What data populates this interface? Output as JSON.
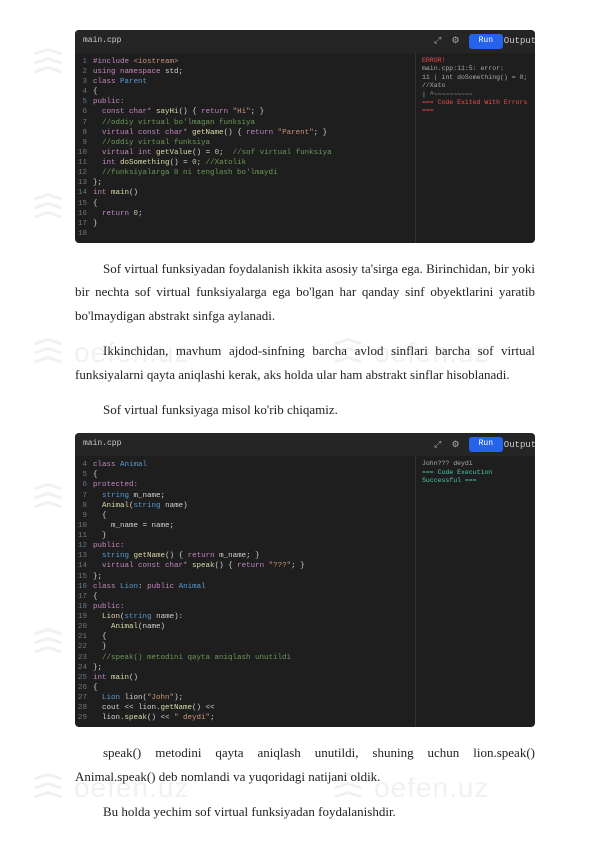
{
  "watermark": "oefen.uz",
  "editor1": {
    "filename": "main.cpp",
    "runLabel": "Run",
    "outputTitle": "Output",
    "lines": [
      {
        "n": "1",
        "html": "<span class='tok-keyword'>#include</span> <span class='tok-string'>&lt;iostream&gt;</span>"
      },
      {
        "n": "2",
        "html": "<span class='tok-keyword'>using namespace</span> <span class='tok-plain'>std;</span>"
      },
      {
        "n": "3",
        "html": "<span class='tok-keyword'>class</span> <span class='tok-type'>Parent</span>"
      },
      {
        "n": "4",
        "html": "<span class='tok-plain'>{</span>"
      },
      {
        "n": "5",
        "html": "<span class='tok-keyword'>public:</span>"
      },
      {
        "n": "6",
        "html": "  <span class='tok-keyword'>const char*</span> <span class='tok-func'>sayHi</span>() { <span class='tok-keyword'>return</span> <span class='tok-string'>\"Hi\"</span>; }"
      },
      {
        "n": "7",
        "html": "  <span class='tok-comment'>//oddiy virtual bo'lmagan funksiya</span>"
      },
      {
        "n": "8",
        "html": "  <span class='tok-keyword'>virtual const char*</span> <span class='tok-func'>getName</span>() { <span class='tok-keyword'>return</span> <span class='tok-string'>\"Parent\"</span>; }"
      },
      {
        "n": "9",
        "html": "  <span class='tok-comment'>//oddiy virtual funksiya</span>"
      },
      {
        "n": "10",
        "html": "  <span class='tok-keyword'>virtual int</span> <span class='tok-func'>getValue</span>() = <span class='tok-number'>0</span>;  <span class='tok-comment'>//sof virtual funksiya</span>"
      },
      {
        "n": "11",
        "html": "  <span class='tok-keyword'>int</span> <span class='tok-func'>doSomething</span>() = <span class='tok-number'>0</span>; <span class='tok-comment'>//Xatolik</span>"
      },
      {
        "n": "12",
        "html": "  <span class='tok-comment'>//funksiyalarga 0 ni tenglash bo'lmaydi</span>"
      },
      {
        "n": "13",
        "html": "<span class='tok-plain'>};</span>"
      },
      {
        "n": "14",
        "html": "<span class='tok-keyword'>int</span> <span class='tok-func'>main</span>()"
      },
      {
        "n": "15",
        "html": "<span class='tok-plain'>{</span>"
      },
      {
        "n": "16",
        "html": "  <span class='tok-keyword'>return</span> <span class='tok-number'>0</span>;"
      },
      {
        "n": "17",
        "html": "<span class='tok-plain'>}</span>"
      },
      {
        "n": "18",
        "html": ""
      }
    ],
    "output": {
      "error": "ERROR!",
      "lines": [
        "main.cpp:11:5: error:",
        "11 |   int  doSomething() = 0; //Xato",
        "   |       ^~~~~~~~~~~",
        "",
        "=== Code Exited With Errors ==="
      ]
    }
  },
  "para1": "Sof virtual funksiyadan foydalanish ikkita asosiy ta'sirga ega. Birinchidan, bir yoki bir nechta sof virtual funksiyalarga ega bo'lgan har qanday sinf obyektlarini yaratib bo'lmaydigan abstrakt sinfga aylanadi.",
  "para2": "Ikkinchidan, mavhum ajdod-sinfning barcha avlod sinflari barcha sof virtual funksiyalarni qayta aniqlashi kerak, aks holda ular ham abstrakt sinflar hisoblanadi.",
  "para3": "Sof virtual funksiyaga misol ko'rib chiqamiz.",
  "editor2": {
    "filename": "main.cpp",
    "runLabel": "Run",
    "outputTitle": "Output",
    "lines": [
      {
        "n": "4",
        "html": "<span class='tok-keyword'>class</span> <span class='tok-type'>Animal</span>"
      },
      {
        "n": "5",
        "html": "<span class='tok-plain'>{</span>"
      },
      {
        "n": "6",
        "html": "<span class='tok-keyword'>protected:</span>"
      },
      {
        "n": "7",
        "html": "  <span class='tok-type'>string</span> m_name;"
      },
      {
        "n": "8",
        "html": "  <span class='tok-func'>Animal</span>(<span class='tok-type'>string</span> name)"
      },
      {
        "n": "9",
        "html": "  {"
      },
      {
        "n": "10",
        "html": "    m_name = name;"
      },
      {
        "n": "11",
        "html": "  }"
      },
      {
        "n": "12",
        "html": "<span class='tok-keyword'>public:</span>"
      },
      {
        "n": "13",
        "html": "  <span class='tok-type'>string</span> <span class='tok-func'>getName</span>() { <span class='tok-keyword'>return</span> m_name; }"
      },
      {
        "n": "14",
        "html": "  <span class='tok-keyword'>virtual const char*</span> <span class='tok-func'>speak</span>() { <span class='tok-keyword'>return</span> <span class='tok-string'>\"???\"</span>; }"
      },
      {
        "n": "15",
        "html": "<span class='tok-plain'>};</span>"
      },
      {
        "n": "16",
        "html": "<span class='tok-keyword'>class</span> <span class='tok-type'>Lion</span>: <span class='tok-keyword'>public</span> <span class='tok-type'>Animal</span>"
      },
      {
        "n": "17",
        "html": "<span class='tok-plain'>{</span>"
      },
      {
        "n": "18",
        "html": "<span class='tok-keyword'>public:</span>"
      },
      {
        "n": "19",
        "html": "  <span class='tok-func'>Lion</span>(<span class='tok-type'>string</span> name):"
      },
      {
        "n": "20",
        "html": "    <span class='tok-func'>Animal</span>(name)"
      },
      {
        "n": "21",
        "html": "  {"
      },
      {
        "n": "22",
        "html": "  }"
      },
      {
        "n": "23",
        "html": "  <span class='tok-comment'>//speak() metodini qayta aniqlash unutildi</span>"
      },
      {
        "n": "24",
        "html": "<span class='tok-plain'>};</span>"
      },
      {
        "n": "25",
        "html": "<span class='tok-keyword'>int</span> <span class='tok-func'>main</span>()"
      },
      {
        "n": "26",
        "html": "<span class='tok-plain'>{</span>"
      },
      {
        "n": "27",
        "html": "  <span class='tok-type'>Lion</span> lion(<span class='tok-string'>\"John\"</span>);"
      },
      {
        "n": "28",
        "html": "  cout &lt;&lt; lion.<span class='tok-func'>getName</span>() &lt;&lt;"
      },
      {
        "n": "29",
        "html": "  lion.<span class='tok-func'>speak</span>() &lt;&lt; <span class='tok-string'>\" deydi\"</span>;"
      }
    ],
    "output": {
      "lines": [
        "John??? deydi",
        "",
        "",
        "=== Code Execution Successful ==="
      ]
    }
  },
  "para4": "speak() metodini qayta aniqlash unutildi, shuning uchun lion.speak() Animal.speak() deb nomlandi va yuqoridagi natijani oldik.",
  "para5": "Bu holda yechim sof virtual funksiyadan foydalanishdir."
}
